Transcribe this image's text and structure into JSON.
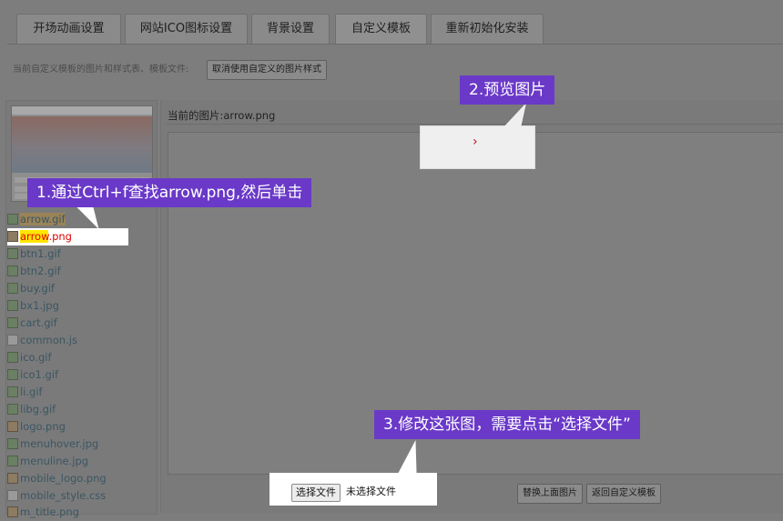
{
  "tabs": [
    {
      "label": "开场动画设置"
    },
    {
      "label": "网站ICO图标设置"
    },
    {
      "label": "背景设置"
    },
    {
      "label": "自定义模板"
    },
    {
      "label": "重新初始化安装"
    }
  ],
  "info_text": "当前自定义模板的图片和样式表、模板文件:",
  "cancel_button": "取消使用自定义的图片样式",
  "current_image_label": "当前的图片:arrow.png",
  "preview_glyph": "›",
  "files": [
    {
      "name": "arrow.gif",
      "icon": "gif-file-icon"
    },
    {
      "name_highlight": "arrow",
      "name_rest": ".png",
      "icon": "png-file-icon"
    },
    {
      "name": "btn1.gif",
      "icon": "gif-file-icon"
    },
    {
      "name": "btn2.gif",
      "icon": "gif-file-icon"
    },
    {
      "name": "buy.gif",
      "icon": "gif-file-icon"
    },
    {
      "name": "bx1.jpg",
      "icon": "jpg-file-icon"
    },
    {
      "name": "cart.gif",
      "icon": "gif-file-icon"
    },
    {
      "name": "common.js",
      "icon": "js-file-icon"
    },
    {
      "name": "ico.gif",
      "icon": "gif-file-icon"
    },
    {
      "name": "ico1.gif",
      "icon": "gif-file-icon"
    },
    {
      "name": "li.gif",
      "icon": "gif-file-icon"
    },
    {
      "name": "libg.gif",
      "icon": "gif-file-icon"
    },
    {
      "name": "logo.png",
      "icon": "png-file-icon"
    },
    {
      "name": "menuhover.jpg",
      "icon": "jpg-file-icon"
    },
    {
      "name": "menuline.jpg",
      "icon": "jpg-file-icon"
    },
    {
      "name": "mobile_logo.png",
      "icon": "png-file-icon"
    },
    {
      "name": "mobile_style.css",
      "icon": "css-file-icon"
    },
    {
      "name": "m_title.png",
      "icon": "png-file-icon"
    }
  ],
  "callouts": {
    "step1": "1.通过Ctrl+f查找arrow.png,然后单击",
    "step2": "2.预览图片",
    "step3": "3.修改这张图，需要点击“选择文件”"
  },
  "file_input": {
    "button": "选择文件",
    "status": "未选择文件"
  },
  "replace_button": "替换上面图片",
  "back_button": "返回自定义模板",
  "colors": {
    "callout": "#6a39c8",
    "highlight": "#ffe600",
    "selected_text": "#e00000"
  }
}
